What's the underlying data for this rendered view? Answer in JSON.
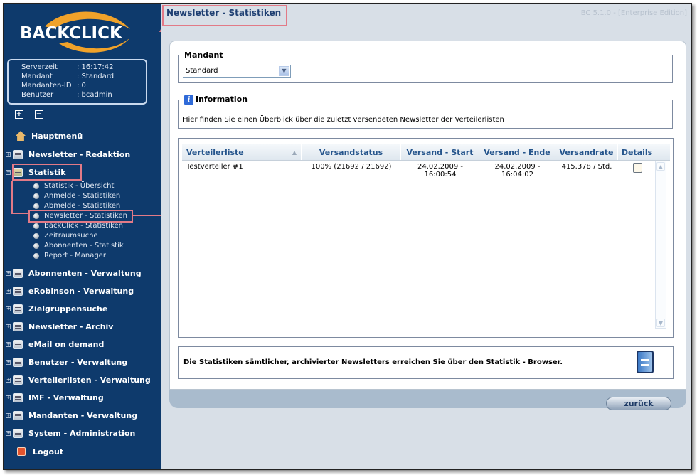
{
  "logo": {
    "text": "BACKCLICK"
  },
  "server_info": [
    {
      "key": "Serverzeit",
      "value": ": 16:17:42"
    },
    {
      "key": "Mandant",
      "value": ": Standard"
    },
    {
      "key": "Mandanten-ID",
      "value": ": 0"
    },
    {
      "key": "Benutzer",
      "value": ": bcadmin"
    }
  ],
  "tree_controls": {
    "expand": "+",
    "collapse": "−"
  },
  "nav": {
    "hauptmenu": "Hauptmenü",
    "redaktion": "Newsletter - Redaktion",
    "statistik": "Statistik",
    "sub": [
      "Statistik - Übersicht",
      "Anmelde - Statistiken",
      "Abmelde - Statistiken",
      "Newsletter - Statistiken",
      "BackClick - Statistiken",
      "Zeitraumsuche",
      "Abonnenten - Statistik",
      "Report - Manager"
    ],
    "items": [
      "Abonnenten - Verwaltung",
      "eRobinson - Verwaltung",
      "Zielgruppensuche",
      "Newsletter - Archiv",
      "eMail on demand",
      "Benutzer - Verwaltung",
      "Verteilerlisten - Verwaltung",
      "IMF - Verwaltung",
      "Mandanten - Verwaltung",
      "System - Administration"
    ],
    "logout": "Logout"
  },
  "page": {
    "title": "Newsletter - Statistiken",
    "version": "BC 5.1.0 - [Enterprise Edition]"
  },
  "mandant": {
    "legend": "Mandant",
    "selected": "Standard"
  },
  "information": {
    "legend": "Information",
    "text": "Hier finden Sie einen Überblick über die zuletzt versendeten Newsletter der Verteilerlisten"
  },
  "table": {
    "columns": [
      "Verteilerliste",
      "Versandstatus",
      "Versand - Start",
      "Versand - Ende",
      "Versandrate",
      "Details"
    ],
    "rows": [
      [
        "Testverteiler #1",
        "100% (21692 / 21692)",
        "24.02.2009 - 16:00:54",
        "24.02.2009 - 16:04:02",
        "415.378 / Std."
      ]
    ]
  },
  "footer_note": "Die Statistiken sämtlicher, archivierter Newsletters erreichen Sie über den Statistik - Browser.",
  "back_button": "zurück",
  "colors": {
    "sidebar": "#0e3a6c",
    "highlight": "#e27a87",
    "header_text": "#26558c"
  }
}
